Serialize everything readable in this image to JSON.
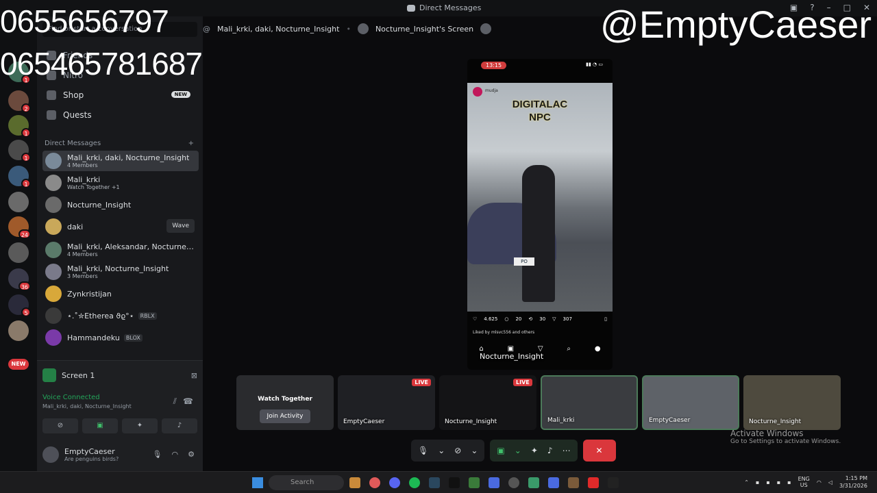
{
  "window": {
    "title": "Direct Messages"
  },
  "overlay": {
    "numbers": [
      "0655656797",
      "065465781687"
    ],
    "handle": "@EmptyCaeser"
  },
  "sidebar": {
    "search_placeholder": "Find or start a conversation",
    "nav": [
      {
        "label": "Friends"
      },
      {
        "label": "Nitro"
      },
      {
        "label": "Shop",
        "badge": "NEW"
      },
      {
        "label": "Quests"
      }
    ],
    "dm_header": "Direct Messages",
    "dms": [
      {
        "name": "Mali_krki, daki, Nocturne_Insight",
        "sub": "4 Members"
      },
      {
        "name": "Mali_krki",
        "sub": "Watch Together +1"
      },
      {
        "name": "Nocturne_Insight",
        "sub": ""
      },
      {
        "name": "daki",
        "sub": "",
        "action": "Wave"
      },
      {
        "name": "Mali_krki, Aleksandar, Nocturne_In...",
        "sub": "4 Members"
      },
      {
        "name": "Mali_krki, Nocturne_Insight",
        "sub": "3 Members"
      },
      {
        "name": "Zynkristijan",
        "sub": ""
      },
      {
        "name": "⋆.˚✮Etherea ϑϱ°⋆",
        "tag": "RBLX"
      },
      {
        "name": "Hammandeku",
        "tag": "BLOX"
      }
    ]
  },
  "servers": {
    "badges": [
      "1",
      "2",
      "1",
      "1",
      "1",
      "1",
      "24",
      "36",
      "5"
    ],
    "new_label": "NEW"
  },
  "voice": {
    "screen_label": "Screen 1",
    "status": "Voice Connected",
    "channel": "Mali_krki, daki, Nocturne_Insight"
  },
  "user": {
    "name": "EmptyCaeser",
    "status": "Are penguins birds?"
  },
  "topbar": {
    "channel": "Mali_krki, daki, Nocturne_Insight",
    "stream": "Nocturne_Insight's Screen"
  },
  "phone": {
    "time": "13:15",
    "account": "mudja",
    "caption_line1": "DIGITALAC",
    "caption_line2": "NPC",
    "plate": "PO",
    "likes": "4.625",
    "comments": "20",
    "reposts": "30",
    "shares": "307",
    "liked_by": "Liked by mlsvc556 and others",
    "label": "Nocturne_Insight"
  },
  "tiles": [
    {
      "title": "Watch Together",
      "button": "Join Activity",
      "label": ""
    },
    {
      "label": "EmptyCaeser",
      "live": "LIVE"
    },
    {
      "label": "Nocturne_Insight",
      "live": "LIVE"
    },
    {
      "label": "Mali_krki"
    },
    {
      "label": "EmptyCaeser"
    },
    {
      "label": "Nocturne_Insight"
    }
  ],
  "activation": {
    "title": "Activate Windows",
    "sub": "Go to Settings to activate Windows."
  },
  "taskbar": {
    "search": "Search",
    "lang": "ENG",
    "region": "US",
    "time": "1:15 PM",
    "date": "3/31/2026"
  }
}
